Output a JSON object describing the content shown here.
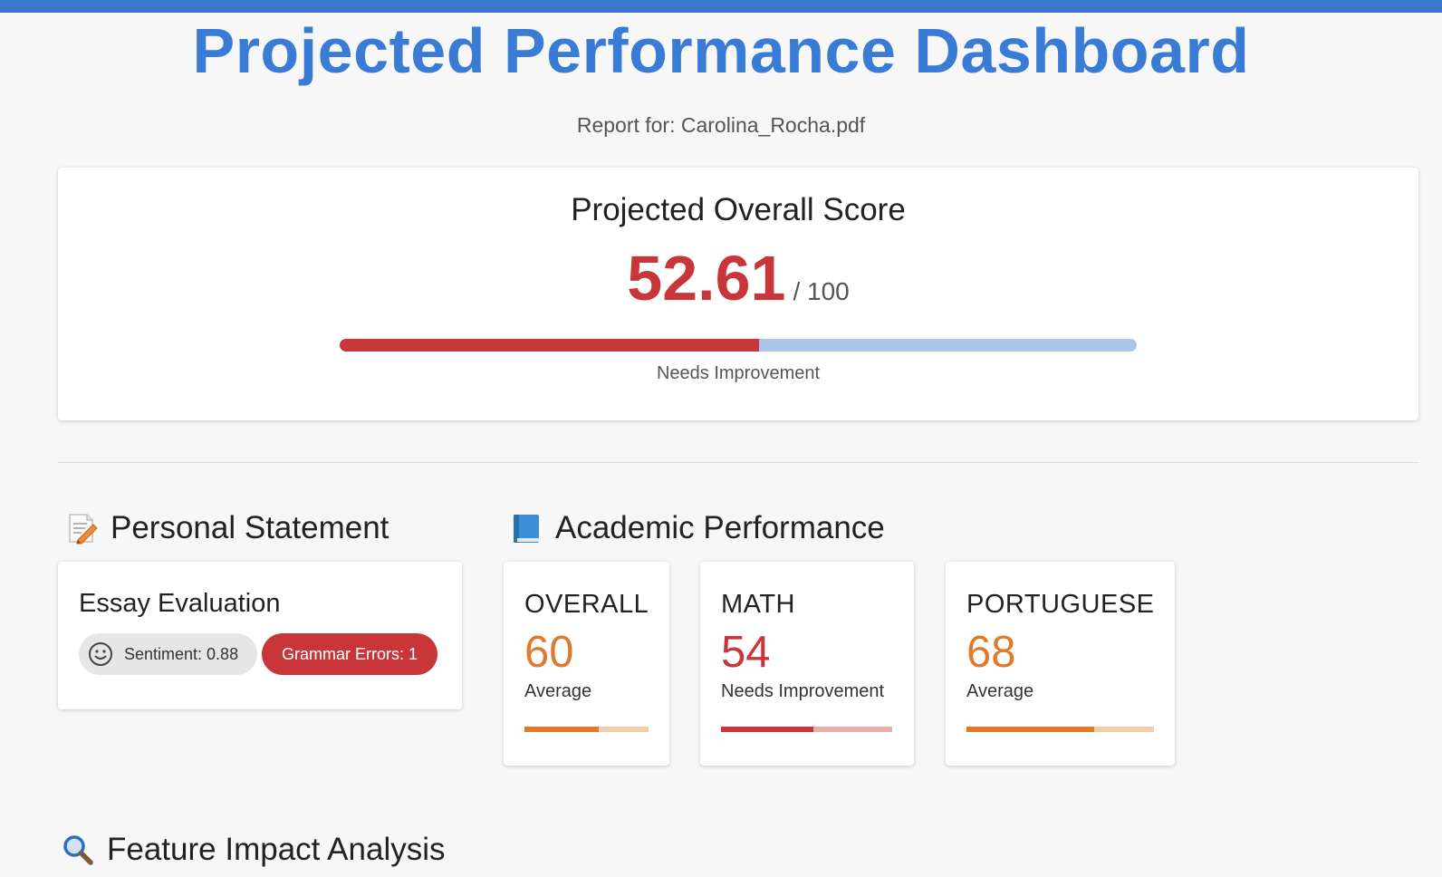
{
  "header": {
    "title": "Projected Performance Dashboard",
    "subtitle": "Report for: Carolina_Rocha.pdf"
  },
  "overall_score": {
    "heading": "Projected Overall Score",
    "value": "52.61",
    "max_label": "/ 100",
    "fraction": 0.5261,
    "status": "Needs Improvement",
    "colors": {
      "fill": "#c9363a",
      "track": "#a9c6ea"
    }
  },
  "personal_statement": {
    "section_title": "Personal Statement",
    "icon": "memo-icon",
    "card_title": "Essay Evaluation",
    "sentiment_label": "Sentiment: 0.88",
    "grammar_label": "Grammar Errors: 1"
  },
  "academic_performance": {
    "section_title": "Academic Performance",
    "icon": "book-icon",
    "metrics": [
      {
        "label": "OVERALL",
        "value": "60",
        "status": "Average",
        "fraction": 0.6,
        "color": "#e07a2e",
        "track": "#f2cda8"
      },
      {
        "label": "MATH",
        "value": "54",
        "status": "Needs Improvement",
        "fraction": 0.54,
        "color": "#c9363a",
        "track": "#e8adaf"
      },
      {
        "label": "PORTUGUESE",
        "value": "68",
        "status": "Average",
        "fraction": 0.68,
        "color": "#e07a2e",
        "track": "#f2cda8"
      }
    ]
  },
  "feature_impact": {
    "section_title": "Feature Impact Analysis",
    "icon": "magnifier-icon"
  }
}
